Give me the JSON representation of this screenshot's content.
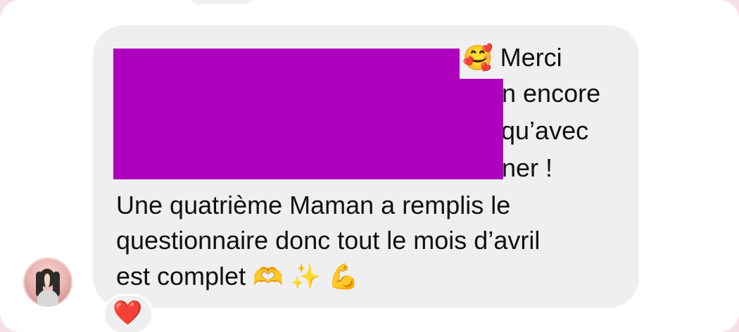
{
  "message": {
    "sender": "contact",
    "lines": {
      "line1_suffix": "Merci",
      "line2_suffix": "n encore",
      "line3_suffix": "qu’avec",
      "line4_suffix": "ner !",
      "line5": "Une quatrième Maman a remplis le",
      "line6": "questionnaire donc tout le mois d’avril",
      "line7_text": "est complet"
    },
    "emojis": {
      "smiling_face": "🥰",
      "heart_hands": "🫶",
      "sparkles": "✨",
      "muscle": "💪"
    },
    "redacted": true,
    "redaction_color": "#b000bf"
  },
  "reaction": {
    "icon": "red-heart-icon",
    "glyph": "❤️"
  },
  "theme": {
    "bubble_background": "#efefef",
    "page_background": "#ffffff",
    "text_color": "#111111"
  }
}
